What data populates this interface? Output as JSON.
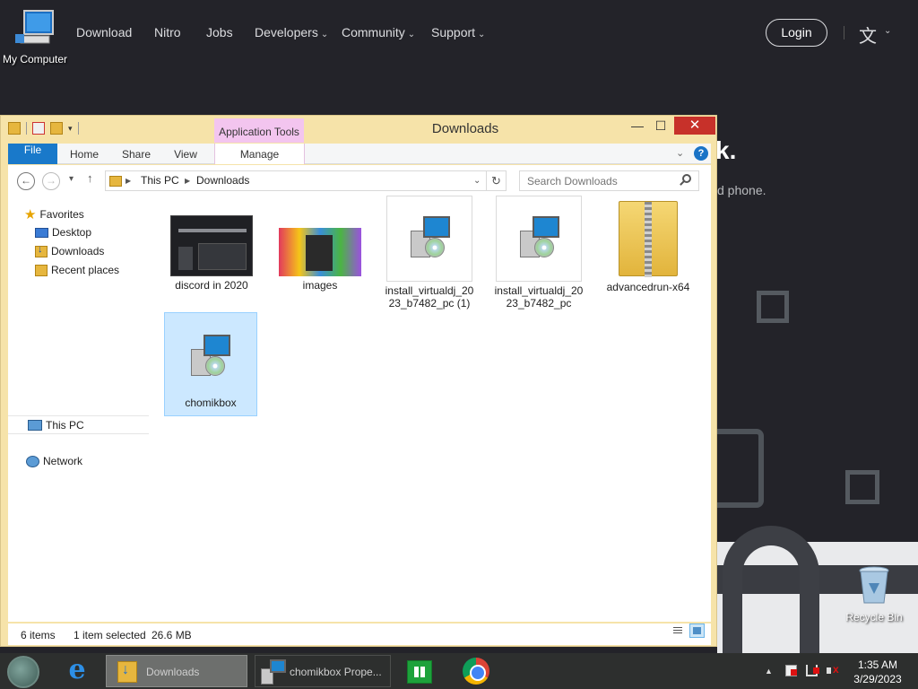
{
  "website": {
    "nav": [
      {
        "label": "Download"
      },
      {
        "label": "Nitro"
      },
      {
        "label": "Jobs"
      },
      {
        "label": "Developers"
      },
      {
        "label": "Community"
      },
      {
        "label": "Support"
      }
    ],
    "login": "Login",
    "hero_fragment": "k.",
    "sub_fragment": "d phone."
  },
  "desktop": {
    "my_computer": "My Computer",
    "recycle_bin": "Recycle Bin"
  },
  "explorer": {
    "title": "Downloads",
    "context_tab": "Application Tools",
    "tabs": {
      "file": "File",
      "home": "Home",
      "share": "Share",
      "view": "View",
      "manage": "Manage"
    },
    "address": {
      "root": "This PC",
      "folder": "Downloads"
    },
    "search_placeholder": "Search Downloads",
    "nav_pane": {
      "favorites": "Favorites",
      "desktop": "Desktop",
      "downloads": "Downloads",
      "recent": "Recent places",
      "this_pc": "This PC",
      "network": "Network"
    },
    "files": [
      {
        "name": "discord in 2020",
        "kind": "image"
      },
      {
        "name": "images",
        "kind": "image"
      },
      {
        "name": "install_virtualdj_2023_b7482_pc (1)",
        "kind": "installer"
      },
      {
        "name": "install_virtualdj_2023_b7482_pc",
        "kind": "installer"
      },
      {
        "name": "advancedrun-x64",
        "kind": "zip"
      },
      {
        "name": "chomikbox",
        "kind": "installer",
        "selected": true
      }
    ],
    "status": {
      "items": "6 items",
      "selected": "1 item selected",
      "size": "26.6 MB"
    }
  },
  "taskbar": {
    "tasks": [
      {
        "label": "Downloads"
      },
      {
        "label": "chomikbox Prope..."
      }
    ],
    "time": "1:35 AM",
    "date": "3/29/2023"
  }
}
